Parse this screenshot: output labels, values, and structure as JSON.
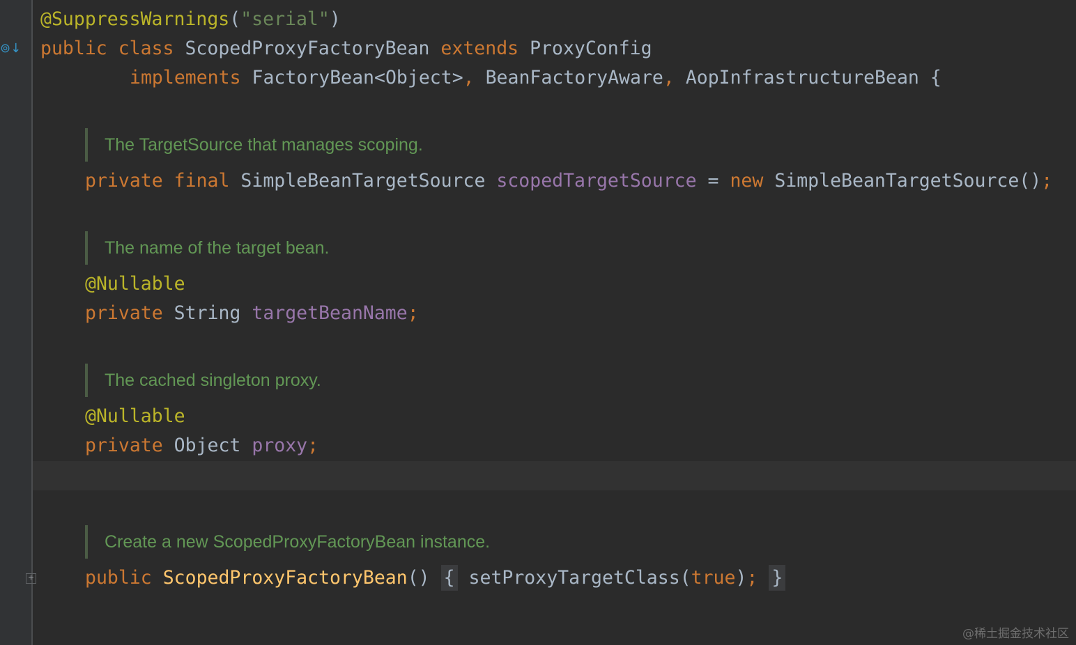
{
  "gutter": {
    "implementation_marker_glyph": "⊚↓",
    "fold_marker_glyph": "+"
  },
  "code": {
    "annotation_line": {
      "at_annotation": "@SuppressWarnings",
      "open_paren": "(",
      "string": "\"serial\"",
      "close_paren": ")"
    },
    "class_decl": {
      "kw_public": "public",
      "kw_class": "class",
      "class_name": "ScopedProxyFactoryBean",
      "kw_extends": "extends",
      "superclass": "ProxyConfig"
    },
    "implements_line": {
      "kw_implements": "implements",
      "iface1": "FactoryBean<Object>",
      "comma1": ",",
      "iface2": "BeanFactoryAware",
      "comma2": ",",
      "iface3": "AopInfrastructureBean",
      "open_brace": "{"
    },
    "doc1": "The TargetSource that manages scoping.",
    "field1": {
      "kw_private": "private",
      "kw_final": "final",
      "type": "SimpleBeanTargetSource",
      "name": "scopedTargetSource",
      "equals": "=",
      "kw_new": "new",
      "ctor_call": "SimpleBeanTargetSource()",
      "semicolon": ";"
    },
    "doc2": "The name of the target bean.",
    "field2": {
      "annotation": "@Nullable",
      "kw_private": "private",
      "type": "String",
      "name": "targetBeanName",
      "semicolon": ";"
    },
    "doc3": "The cached singleton proxy.",
    "field3": {
      "annotation": "@Nullable",
      "kw_private": "private",
      "type": "Object",
      "name": "proxy",
      "semicolon": ";"
    },
    "doc4": "Create a new ScopedProxyFactoryBean instance.",
    "ctor": {
      "kw_public": "public",
      "name": "ScopedProxyFactoryBean",
      "parens": "()",
      "open_brace": "{",
      "call": "setProxyTargetClass(",
      "kw_true": "true",
      "close_call": ")",
      "semicolon": ";",
      "close_brace": "}"
    }
  },
  "watermark": "@稀土掘金技术社区"
}
